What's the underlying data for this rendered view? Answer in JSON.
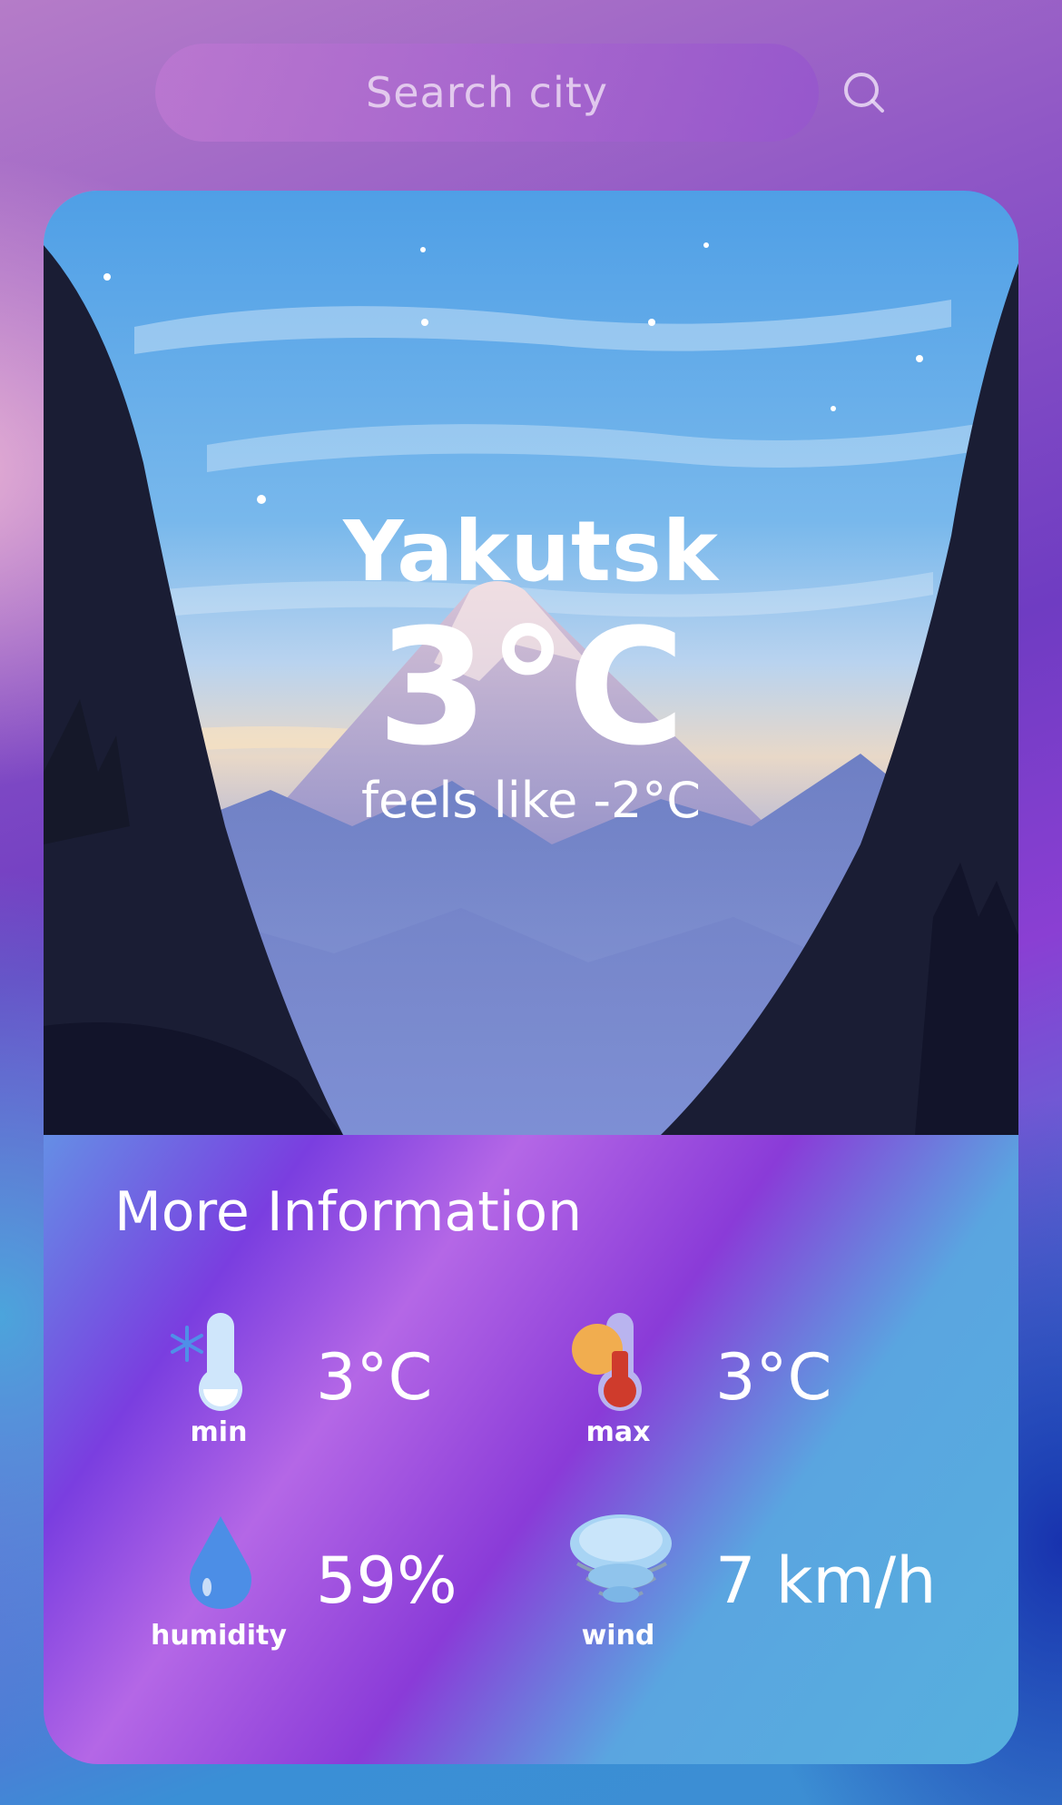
{
  "search": {
    "placeholder": "Search city",
    "icon": "search-icon"
  },
  "weather": {
    "city": "Yakutsk",
    "temperature": "3°C",
    "feels_like": "feels like -2°C",
    "background": "mountain-valley-illustration"
  },
  "more_info": {
    "title": "More Information",
    "stats": [
      {
        "icon": "thermometer-cold-icon",
        "label": "min",
        "value": "3°C"
      },
      {
        "icon": "thermometer-hot-icon",
        "label": "max",
        "value": "3°C"
      },
      {
        "icon": "water-drop-icon",
        "label": "humidity",
        "value": "59%"
      },
      {
        "icon": "wind-cloud-icon",
        "label": "wind",
        "value": "7 km/h"
      }
    ]
  },
  "colors": {
    "accent_purple": "#8a3bd8",
    "accent_blue": "#5ab8e8",
    "text": "#ffffff"
  }
}
